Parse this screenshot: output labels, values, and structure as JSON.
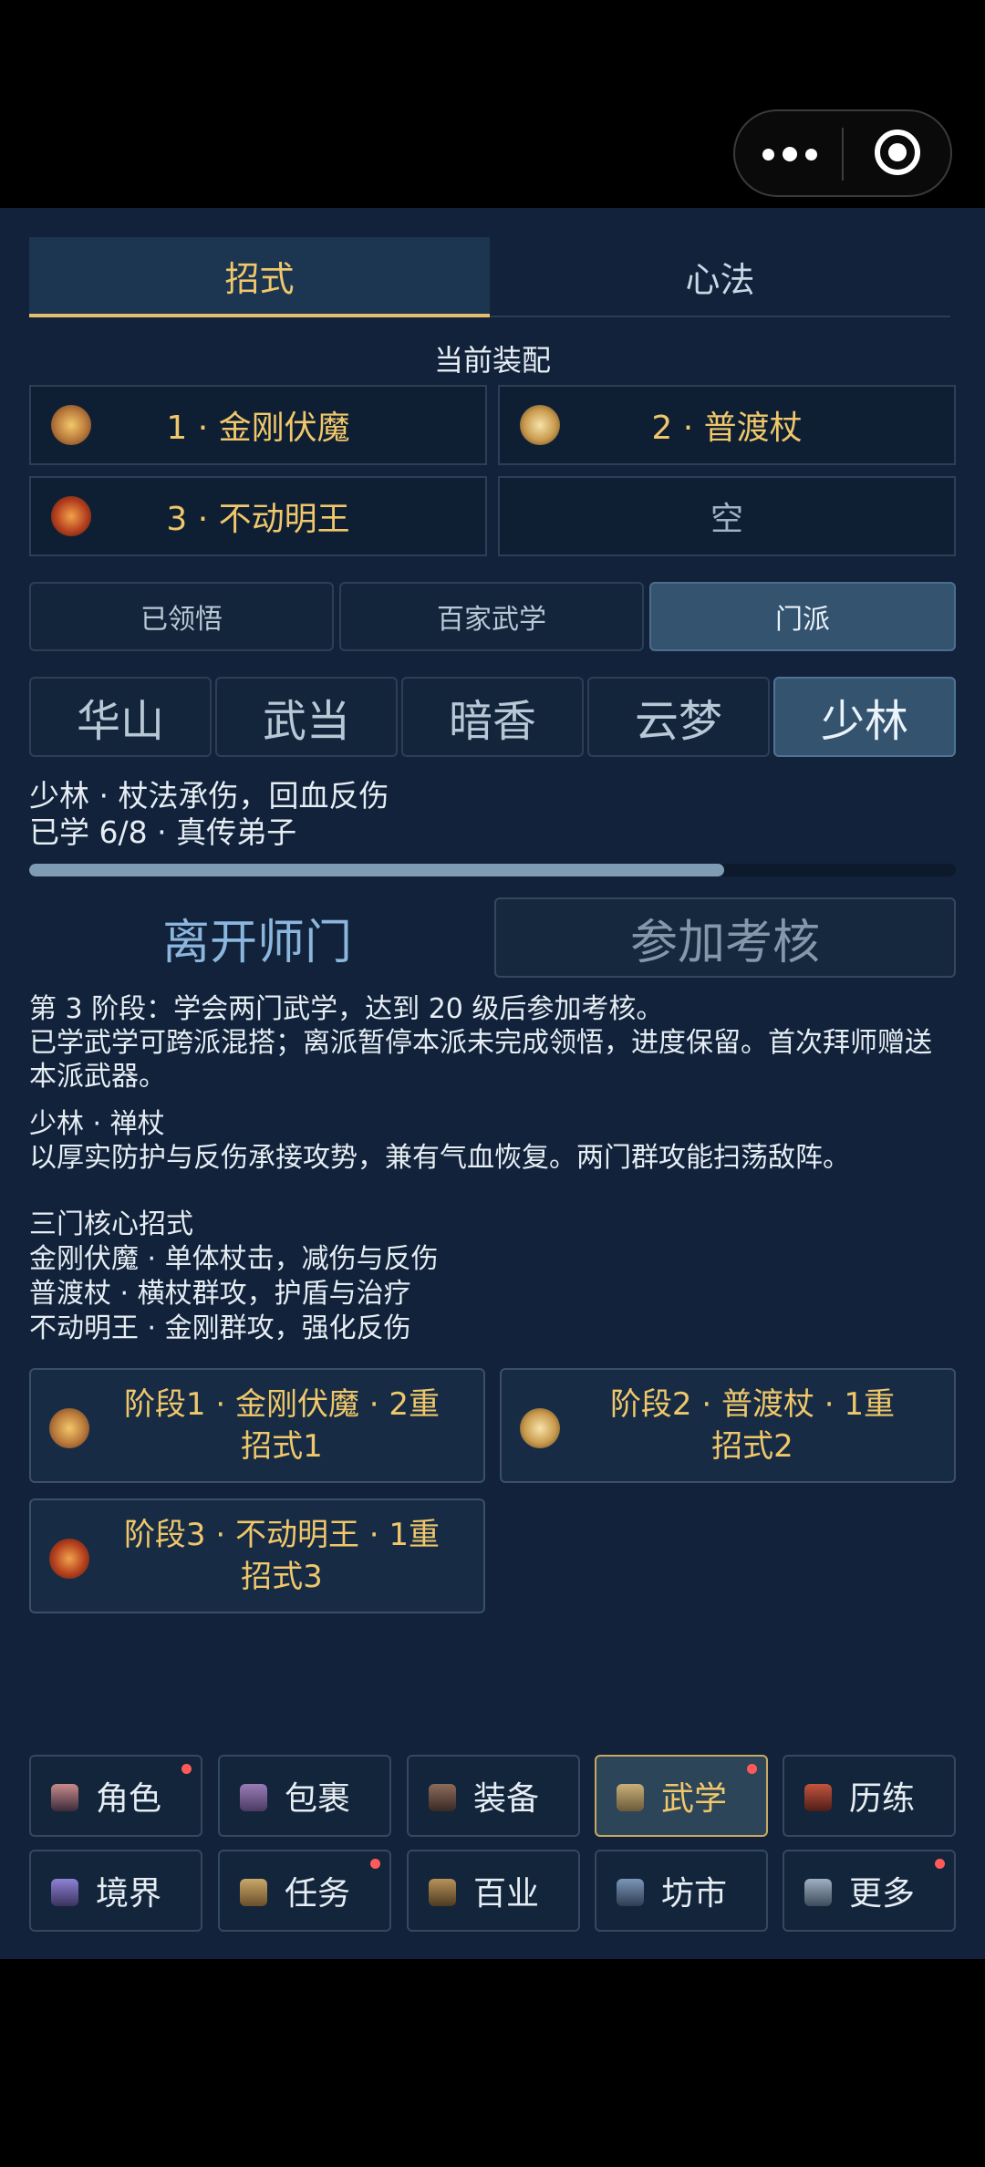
{
  "tabs": {
    "active": "招式",
    "items": [
      "招式",
      "心法"
    ]
  },
  "equip": {
    "label": "当前装配",
    "slots": [
      "1 · 金刚伏魔",
      "2 · 普渡杖",
      "3 · 不动明王",
      "空"
    ]
  },
  "subtabs": [
    "已领悟",
    "百家武学",
    "门派"
  ],
  "sects": [
    "华山",
    "武当",
    "暗香",
    "云梦",
    "少林"
  ],
  "sect_info": {
    "line1": "少林 · 杖法承伤，回血反伤",
    "line2": "已学 6/8 · 真传弟子",
    "progress": 0.75
  },
  "actions": {
    "leave": "离开师门",
    "exam": "参加考核"
  },
  "stage": {
    "desc": "第 3 阶段：学会两门武学，达到 20 级后参加考核。",
    "extra": "已学武学可跨派混搭；离派暂停本派未完成领悟，进度保留。首次拜师赠送本派武器。"
  },
  "sect_detail": {
    "name": "少林 · 禅杖",
    "desc": "以厚实防护与反伤承接攻势，兼有气血恢复。两门群攻能扫荡敌阵。"
  },
  "core": {
    "title": "三门核心招式",
    "items": [
      "金刚伏魔 · 单体杖击，减伤与反伤",
      "普渡杖 · 横杖群攻，护盾与治疗",
      "不动明王 · 金刚群攻，强化反伤"
    ]
  },
  "stage_cards": [
    {
      "line1": "阶段1 · 金刚伏魔 · 2重",
      "line2": "招式1"
    },
    {
      "line1": "阶段2 · 普渡杖 · 1重",
      "line2": "招式2"
    },
    {
      "line1": "阶段3 · 不动明王 · 1重",
      "line2": "招式3"
    }
  ],
  "nav": {
    "row1": [
      "角色",
      "包裹",
      "装备",
      "武学",
      "历练"
    ],
    "row2": [
      "境界",
      "任务",
      "百业",
      "坊市",
      "更多"
    ],
    "active": "武学",
    "badges": [
      "角色",
      "武学",
      "任务",
      "更多"
    ]
  },
  "colors": {
    "accent": "#f0c76a",
    "background": "#11223a",
    "badge": "#ff5a5a"
  }
}
